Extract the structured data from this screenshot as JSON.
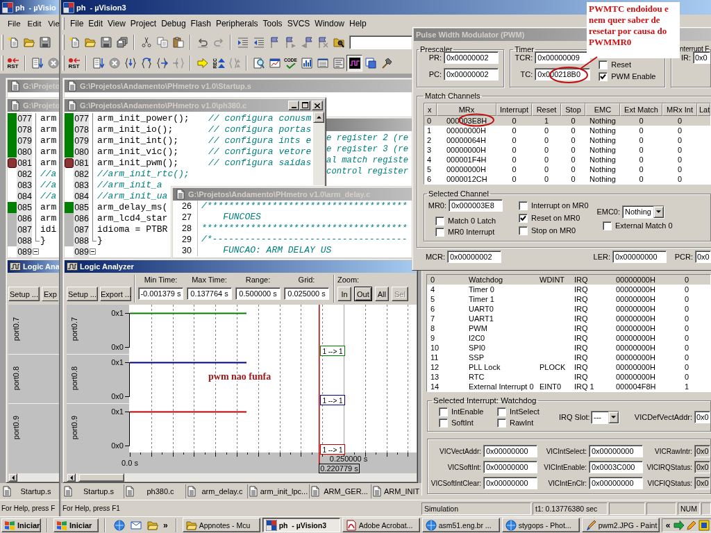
{
  "left_window": {
    "title": "ph  - µVisio",
    "menu": [
      "File",
      "Edit",
      "Vie"
    ],
    "reset_label": "RST",
    "editor_titles": [
      "G:\\Projeto",
      "G:\\Projeto"
    ],
    "code_lines": [
      {
        "number": "077",
        "code": "arm",
        "kind": "executed",
        "fold_start": false
      },
      {
        "number": "078",
        "code": "arm",
        "kind": "executed",
        "fold_start": false
      },
      {
        "number": "079",
        "code": "arm",
        "kind": "executed",
        "fold_start": false
      },
      {
        "number": "080",
        "code": "arm",
        "kind": "executed",
        "fold_start": false
      },
      {
        "number": "081",
        "code": "arm",
        "kind": "breakpoint",
        "fold_start": false
      },
      {
        "number": "082",
        "comment": "//a",
        "kind": "plain",
        "fold_start": false
      },
      {
        "number": "083",
        "comment": "//a",
        "kind": "plain",
        "fold_start": false
      },
      {
        "number": "084",
        "comment": "//a",
        "kind": "plain",
        "fold_start": false
      },
      {
        "number": "085",
        "code": "arm",
        "kind": "executed",
        "fold_start": false
      },
      {
        "number": "086",
        "code": "arm",
        "kind": "not_executed",
        "fold_start": false
      },
      {
        "number": "087",
        "code": "idi",
        "kind": "not_executed",
        "fold_start": false
      },
      {
        "number": "088",
        "code": "}",
        "kind": "not_executed",
        "fold_start": false
      },
      {
        "number": "089",
        "kind": "plain",
        "fold_start": true
      }
    ],
    "logic_analyzer": {
      "title": "Logic Ana",
      "buttons": [
        "Setup ...",
        "Exp"
      ],
      "signals": [
        "port0.7",
        "port0.8",
        "port0.9"
      ]
    },
    "tabs": [
      "Startup.s"
    ],
    "status": "For Help, press F"
  },
  "main_window": {
    "title": "ph  - µVision3",
    "menu": [
      "File",
      "Edit",
      "View",
      "Project",
      "Debug",
      "Flash",
      "Peripherals",
      "Tools",
      "SVCS",
      "Window",
      "Help"
    ],
    "reset_label": "RST",
    "trace_label": "REC",
    "coverage_label": "CODE",
    "editors": {
      "startup": {
        "title": "G:\\Projetos\\Andamento\\PHmetro v1.0\\Startup.s"
      },
      "background_lines": [
        "e register 2 (re",
        "e register 3 (re",
        "al match registe",
        "control register"
      ],
      "ph380": {
        "title": "G:\\Projetos\\Andamento\\PHmetro v1.0\\ph380.c",
        "lines": [
          {
            "number": "077",
            "code": "arm_init_power();",
            "comment": "// configura conusm",
            "kind": "executed",
            "fold_start": false
          },
          {
            "number": "078",
            "code": "arm_init_io();",
            "comment": "// configura portas",
            "kind": "executed",
            "fold_start": false
          },
          {
            "number": "079",
            "code": "arm_init_int();",
            "comment": "// configura ints e",
            "kind": "executed",
            "fold_start": false
          },
          {
            "number": "080",
            "code": "arm_init_vic();",
            "comment": "// configura vetore",
            "kind": "executed",
            "fold_start": false
          },
          {
            "number": "081",
            "code": "arm_init_pwm();",
            "comment": "// configura saidas",
            "kind": "breakpoint",
            "fold_start": false
          },
          {
            "number": "082",
            "comment": "//arm_init_rtc();",
            "kind": "plain",
            "fold_start": false
          },
          {
            "number": "083",
            "comment": "//arm_init_a",
            "kind": "plain",
            "fold_start": false
          },
          {
            "number": "084",
            "comment": "//arm_init_ua",
            "kind": "plain",
            "fold_start": false
          },
          {
            "number": "085",
            "code": "arm_delay_ms(",
            "kind": "executed",
            "fold_start": false
          },
          {
            "number": "086",
            "code": "arm_lcd4_star",
            "kind": "not_executed",
            "fold_start": false
          },
          {
            "number": "087",
            "code": "idioma = PTBR",
            "kind": "not_executed",
            "fold_start": false
          },
          {
            "number": "088",
            "code": "}",
            "kind": "not_executed",
            "fold_start": false
          },
          {
            "number": "089",
            "kind": "plain",
            "fold_start": true
          }
        ]
      },
      "arm_delay": {
        "title": "G:\\Projetos\\Andamento\\PHmetro v1.0\\arm_delay.c",
        "lines": [
          {
            "number": "26",
            "comment": "/*************************************"
          },
          {
            "number": "27",
            "comment": "    FUNCOES"
          },
          {
            "number": "28",
            "comment": "**************************************"
          },
          {
            "number": "29",
            "comment": "/*------------------------------------"
          },
          {
            "number": "30",
            "comment": "    FUNCAO: ARM DELAY US"
          }
        ]
      }
    },
    "logic_analyzer": {
      "title": "Logic Analyzer",
      "buttons": [
        "Setup ...",
        "Export ..."
      ],
      "readouts": [
        {
          "label": "Min Time:",
          "value": "-0.001379 s"
        },
        {
          "label": "Max Time:",
          "value": "0.137764 s"
        },
        {
          "label": "Range:",
          "value": "0.500000 s"
        },
        {
          "label": "Grid:",
          "value": "0.025000 s"
        }
      ],
      "zoom_label": "Zoom:",
      "zoom_buttons": [
        {
          "label": "In",
          "default": false,
          "disabled": false
        },
        {
          "label": "Out",
          "default": true,
          "disabled": false
        },
        {
          "label": "All",
          "default": false,
          "disabled": false
        },
        {
          "label": "Sel",
          "default": false,
          "disabled": true
        }
      ],
      "signals": [
        {
          "name": "port0.7",
          "high": "0x1",
          "low": "0x0",
          "color": "#008000",
          "transition": "1 --> 1"
        },
        {
          "name": "port0.8",
          "high": "0x1",
          "low": "0x0",
          "color": "#000080",
          "transition": "1 --> 1"
        },
        {
          "name": "port0.9",
          "high": "0x1",
          "low": "0x0",
          "color": "#c00000",
          "transition": "1 --> 1"
        }
      ],
      "time_labels": [
        "0.0 s",
        "0.250000 s"
      ],
      "cursor_time": "0.220779 s",
      "note": "pwm nao funfa"
    },
    "tabs": [
      "Startup.s",
      "ph380.c",
      "arm_delay.c",
      "arm_init_lpc...",
      "ARM_GER...",
      "ARM_INIT"
    ],
    "status_bar": {
      "help": "For Help, press F1",
      "mode": "Simulation",
      "time": "t1: 0.13776380 sec",
      "indicator": "NUM"
    }
  },
  "pwm_dialog": {
    "title": "Pulse Width Modulator (PWM)",
    "prescaler": {
      "label": "Prescaler",
      "fields": [
        {
          "label": "PR:",
          "value": "0x00000002"
        },
        {
          "label": "PC:",
          "value": "0x00000002"
        }
      ]
    },
    "timer": {
      "label": "Timer",
      "fields": [
        {
          "label": "TCR:",
          "value": "0x00000009"
        },
        {
          "label": "TC:",
          "value": "0x000218B0"
        }
      ],
      "options": [
        {
          "label": "Reset",
          "checked": false
        },
        {
          "label": "PWM Enable",
          "checked": true
        }
      ]
    },
    "interrupt": {
      "label": "nterrupt F",
      "field": {
        "label": "IR:",
        "value": "0x0"
      }
    },
    "match_channels": {
      "label": "Match Channels",
      "columns": [
        "x",
        "MRx",
        "Interrupt",
        "Reset",
        "Stop",
        "EMC",
        "Ext Match",
        "MRx Int",
        "Lat"
      ],
      "rows": [
        {
          "cells": [
            "0",
            "000003E8H",
            "0",
            "1",
            "0",
            "Nothing",
            "0",
            "0"
          ],
          "selected": true
        },
        {
          "cells": [
            "1",
            "00000000H",
            "0",
            "0",
            "0",
            "Nothing",
            "0",
            "0"
          ],
          "selected": false
        },
        {
          "cells": [
            "2",
            "00000064H",
            "0",
            "0",
            "0",
            "Nothing",
            "0",
            "0"
          ],
          "selected": false
        },
        {
          "cells": [
            "3",
            "00000000H",
            "0",
            "0",
            "0",
            "Nothing",
            "0",
            "0"
          ],
          "selected": false
        },
        {
          "cells": [
            "4",
            "000001F4H",
            "0",
            "0",
            "0",
            "Nothing",
            "0",
            "0"
          ],
          "selected": false
        },
        {
          "cells": [
            "5",
            "00000000H",
            "0",
            "0",
            "0",
            "Nothing",
            "0",
            "0"
          ],
          "selected": false
        },
        {
          "cells": [
            "6",
            "0000012CH",
            "0",
            "0",
            "0",
            "Nothing",
            "0",
            "0"
          ],
          "selected": false
        }
      ]
    },
    "selected_channel": {
      "label": "Selected Channel",
      "field": {
        "label": "MR0:",
        "value": "0x000003E8"
      },
      "latch_options": [
        {
          "label": "Match 0 Latch",
          "checked": false
        },
        {
          "label": "MR0 Interrupt",
          "checked": false
        }
      ],
      "match_options": [
        {
          "label": "Interrupt on MR0",
          "checked": false
        },
        {
          "label": "Reset on MR0",
          "checked": true
        },
        {
          "label": "Stop on MR0",
          "checked": false
        }
      ],
      "emc": {
        "label": "EMC0:",
        "value": "Nothing"
      },
      "external_match": {
        "label": "External Match 0",
        "checked": false
      }
    },
    "registers": [
      {
        "label": "MCR:",
        "value": "0x00000002"
      },
      {
        "label": "LER:",
        "value": "0x00000000"
      },
      {
        "label": "PCR:",
        "value": "0x0"
      }
    ]
  },
  "annotation": {
    "text": "PWMTC endoidou e\nnem quer saber de\nresetar por causa do\nPWMMR0"
  },
  "vic_dialog": {
    "rows": [
      {
        "cells": [
          "0",
          "Watchdog",
          "WDINT",
          "IRQ",
          "00000000H",
          "0"
        ],
        "selected": true
      },
      {
        "cells": [
          "4",
          "Timer 0",
          "",
          "IRQ",
          "00000000H",
          "0"
        ],
        "selected": false
      },
      {
        "cells": [
          "5",
          "Timer 1",
          "",
          "IRQ",
          "00000000H",
          "0"
        ],
        "selected": false
      },
      {
        "cells": [
          "6",
          "UART0",
          "",
          "IRQ",
          "00000000H",
          "0"
        ],
        "selected": false
      },
      {
        "cells": [
          "7",
          "UART1",
          "",
          "IRQ",
          "00000000H",
          "0"
        ],
        "selected": false
      },
      {
        "cells": [
          "8",
          "PWM",
          "",
          "IRQ",
          "00000000H",
          "0"
        ],
        "selected": false
      },
      {
        "cells": [
          "9",
          "I2C0",
          "",
          "IRQ",
          "00000000H",
          "0"
        ],
        "selected": false
      },
      {
        "cells": [
          "10",
          "SPI0",
          "",
          "IRQ",
          "00000000H",
          "0"
        ],
        "selected": false
      },
      {
        "cells": [
          "11",
          "SSP",
          "",
          "IRQ",
          "00000000H",
          "0"
        ],
        "selected": false
      },
      {
        "cells": [
          "12",
          "PLL Lock",
          "PLOCK",
          "IRQ",
          "00000000H",
          "0"
        ],
        "selected": false
      },
      {
        "cells": [
          "13",
          "RTC",
          "",
          "IRQ",
          "00000000H",
          "0"
        ],
        "selected": false
      },
      {
        "cells": [
          "14",
          "External Interrupt 0",
          "EINT0",
          "IRQ 1",
          "000004F8H",
          "1"
        ],
        "selected": false
      }
    ],
    "selected_interrupt": {
      "label": "Selected Interrupt: Watchdog",
      "options": [
        {
          "label": "IntEnable",
          "checked": false
        },
        {
          "label": "IntSelect",
          "checked": false
        },
        {
          "label": "SoftInt",
          "checked": false
        },
        {
          "label": "RawInt",
          "checked": false
        }
      ],
      "irq_slot": {
        "label": "IRQ Slot:",
        "value": "---"
      },
      "default_vector": {
        "label": "VICDefVectAddr:",
        "value": "0x0"
      }
    },
    "registers": [
      {
        "label": "VICVectAddr:",
        "value": "0x00000000"
      },
      {
        "label": "VICIntSelect:",
        "value": "0x00000000"
      },
      {
        "label": "VICRawIntr:",
        "value": "0x0"
      },
      {
        "label": "VICSoftInt:",
        "value": "0x00000000"
      },
      {
        "label": "VICIntEnable:",
        "value": "0x0003C000"
      },
      {
        "label": "VICIRQStatus:",
        "value": "0x0"
      },
      {
        "label": "VICSoftIntClear:",
        "value": "0x00000000"
      },
      {
        "label": "VICIntEnClr:",
        "value": "0x00000000"
      },
      {
        "label": "VICFIQStatus:",
        "value": "0x0"
      }
    ]
  },
  "taskbar": {
    "start_buttons": [
      "Iniciar",
      "Iniciar"
    ],
    "quick_launch_more": "»",
    "tasks": [
      {
        "label": "Appnotes - Mcu",
        "selected": false
      },
      {
        "label": "ph  - µVision3",
        "selected": true
      },
      {
        "label": "Adobe Acrobat...",
        "selected": false
      },
      {
        "label": "asm51.eng.br ...",
        "selected": false
      },
      {
        "label": "stygops - Phot...",
        "selected": false
      },
      {
        "label": "pwm2.JPG - Paint",
        "selected": false
      }
    ],
    "tray_expand": "«"
  }
}
